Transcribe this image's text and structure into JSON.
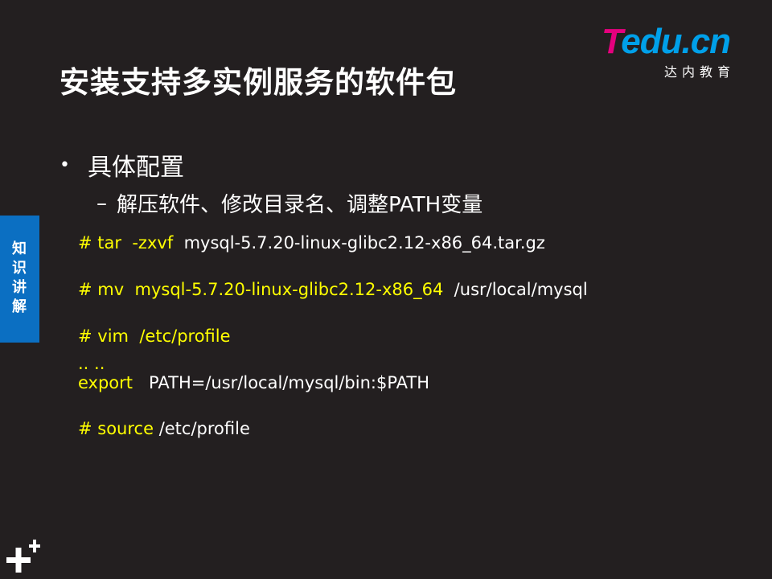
{
  "slide": {
    "title": "安装支持多实例服务的软件包",
    "logo": {
      "wordmark_t": "T",
      "wordmark_rest": "edu.cn",
      "subtitle": "达内教育",
      "colors": {
        "magenta": "#e6007e",
        "blue": "#00a0e9"
      }
    },
    "side_tab": {
      "label": "知识讲解",
      "color": "#0b6fc2"
    },
    "bullet": {
      "label": "具体配置",
      "sub_label": "解压软件、修改目录名、调整PATH变量"
    },
    "code": {
      "line1": {
        "cmd": "# tar  -zxvf",
        "arg": "  mysql-5.7.20-linux-glibc2.12-x86_64.tar.gz"
      },
      "line2": {
        "cmd": "# mv  mysql-5.7.20-linux-glibc2.12-x86_64",
        "arg": "  /usr/local/mysql"
      },
      "line3": {
        "cmd": "# vim  /etc/profile"
      },
      "line4": {
        "cmd": ".. .."
      },
      "line5": {
        "cmd": "export",
        "arg": "   PATH=/usr/local/mysql/bin:$PATH"
      },
      "line6": {
        "cmd": "# source",
        "arg": " /etc/profile"
      }
    },
    "colors": {
      "background": "#231f20",
      "highlight": "#ffff00",
      "text": "#ffffff"
    },
    "corner_icon": "plus-plus-icon"
  }
}
